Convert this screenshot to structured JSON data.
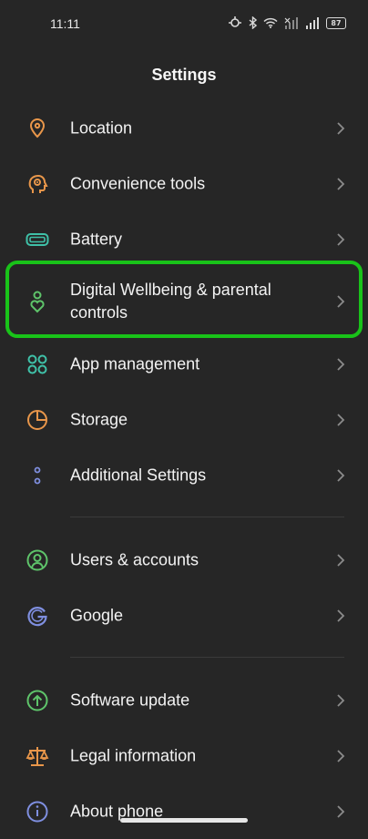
{
  "status_bar": {
    "time": "11:11",
    "battery": "87"
  },
  "header": {
    "title": "Settings"
  },
  "items": [
    {
      "label": "Location",
      "icon": "location-pin-icon",
      "color": "#e8964a"
    },
    {
      "label": "Convenience tools",
      "icon": "head-gear-icon",
      "color": "#e8964a"
    },
    {
      "label": "Battery",
      "icon": "battery-icon",
      "color": "#3fc1a8"
    },
    {
      "label": "Digital Wellbeing & parental controls",
      "icon": "person-heart-icon",
      "color": "#5ec46a"
    },
    {
      "label": "App management",
      "icon": "grid-icon",
      "color": "#3fc1a8"
    },
    {
      "label": "Storage",
      "icon": "pie-chart-icon",
      "color": "#e8964a"
    },
    {
      "label": "Additional Settings",
      "icon": "dots-icon",
      "color": "#7f8fe0"
    },
    {
      "label": "Users & accounts",
      "icon": "user-circle-icon",
      "color": "#5ec46a"
    },
    {
      "label": "Google",
      "icon": "google-icon",
      "color": "#7f8fe0"
    },
    {
      "label": "Software update",
      "icon": "update-arrow-icon",
      "color": "#5ec46a"
    },
    {
      "label": "Legal information",
      "icon": "scales-icon",
      "color": "#e8964a"
    },
    {
      "label": "About phone",
      "icon": "info-icon",
      "color": "#7f8fe0"
    }
  ]
}
